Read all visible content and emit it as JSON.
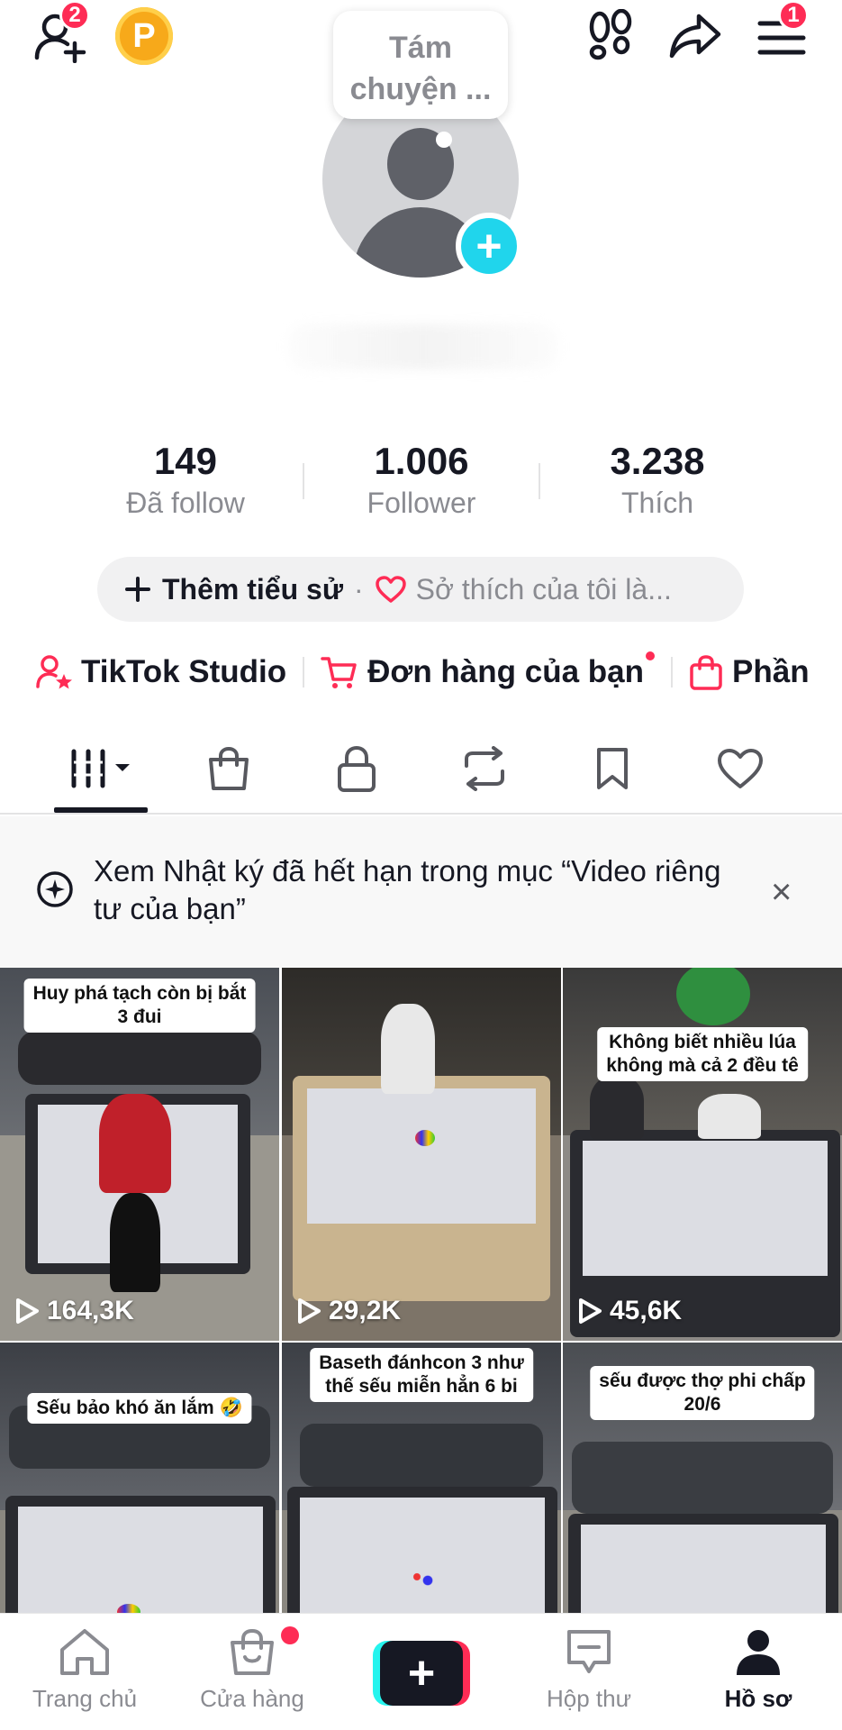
{
  "top_bar": {
    "add_friends_badge": "2",
    "coin_letter": "P",
    "menu_badge": "1",
    "icons": [
      "add-friend-icon",
      "coin-icon",
      "footprints-icon",
      "share-icon",
      "menu-icon"
    ]
  },
  "profile": {
    "avatar_bubble": "Tám\nchuyện ...",
    "stats": [
      {
        "value": "149",
        "label": "Đã follow"
      },
      {
        "value": "1.006",
        "label": "Follower"
      },
      {
        "value": "3.238",
        "label": "Thích"
      }
    ],
    "add_bio_label": "Thêm tiểu sử",
    "separator": "·",
    "hobby_placeholder": "Sở thích của tôi là..."
  },
  "quick_links": [
    {
      "label": "TikTok Studio",
      "icon": "person-star-icon"
    },
    {
      "label": "Đơn hàng của bạn",
      "icon": "cart-icon",
      "has_dot": true
    },
    {
      "label": "Phần",
      "icon": "shopping-bag-icon"
    }
  ],
  "tabs": [
    {
      "name": "videos",
      "icon": "grid-icon",
      "active": true
    },
    {
      "name": "shop",
      "icon": "shopping-bag-icon"
    },
    {
      "name": "private",
      "icon": "lock-icon"
    },
    {
      "name": "reposts",
      "icon": "repost-icon"
    },
    {
      "name": "saved",
      "icon": "bookmark-icon"
    },
    {
      "name": "liked",
      "icon": "heart-icon"
    }
  ],
  "notice": {
    "text": "Xem Nhật ký đã hết hạn trong mục “Video riêng tư của bạn”",
    "close": "×"
  },
  "videos": [
    {
      "caption": "Huy phá tạch còn bị bắt\n3 đui",
      "views": "164,3K"
    },
    {
      "caption": "",
      "views": "29,2K"
    },
    {
      "caption": "Không biết nhiều lúa\nkhông mà cả 2 đều tê",
      "views": "45,6K"
    },
    {
      "caption": "Sếu bảo khó ăn lắm 🤣",
      "views": ""
    },
    {
      "caption": "Baseth đánhcon 3 như\nthế sếu miễn hẳn 6 bi",
      "views": ""
    },
    {
      "caption": "sếu được thợ phi chấp\n20/6",
      "views": ""
    }
  ],
  "bottom_nav": [
    {
      "label": "Trang chủ",
      "icon": "home-icon"
    },
    {
      "label": "Cửa hàng",
      "icon": "shop-bag-icon",
      "has_dot": true
    },
    {
      "label": "+",
      "icon": "create-icon"
    },
    {
      "label": "Hộp thư",
      "icon": "inbox-icon"
    },
    {
      "label": "Hồ sơ",
      "icon": "profile-icon",
      "active": true
    }
  ],
  "colors": {
    "accent_red": "#fe2c55",
    "accent_cyan": "#20d5ec",
    "text_primary": "#161823",
    "text_secondary": "#8a8b91"
  }
}
